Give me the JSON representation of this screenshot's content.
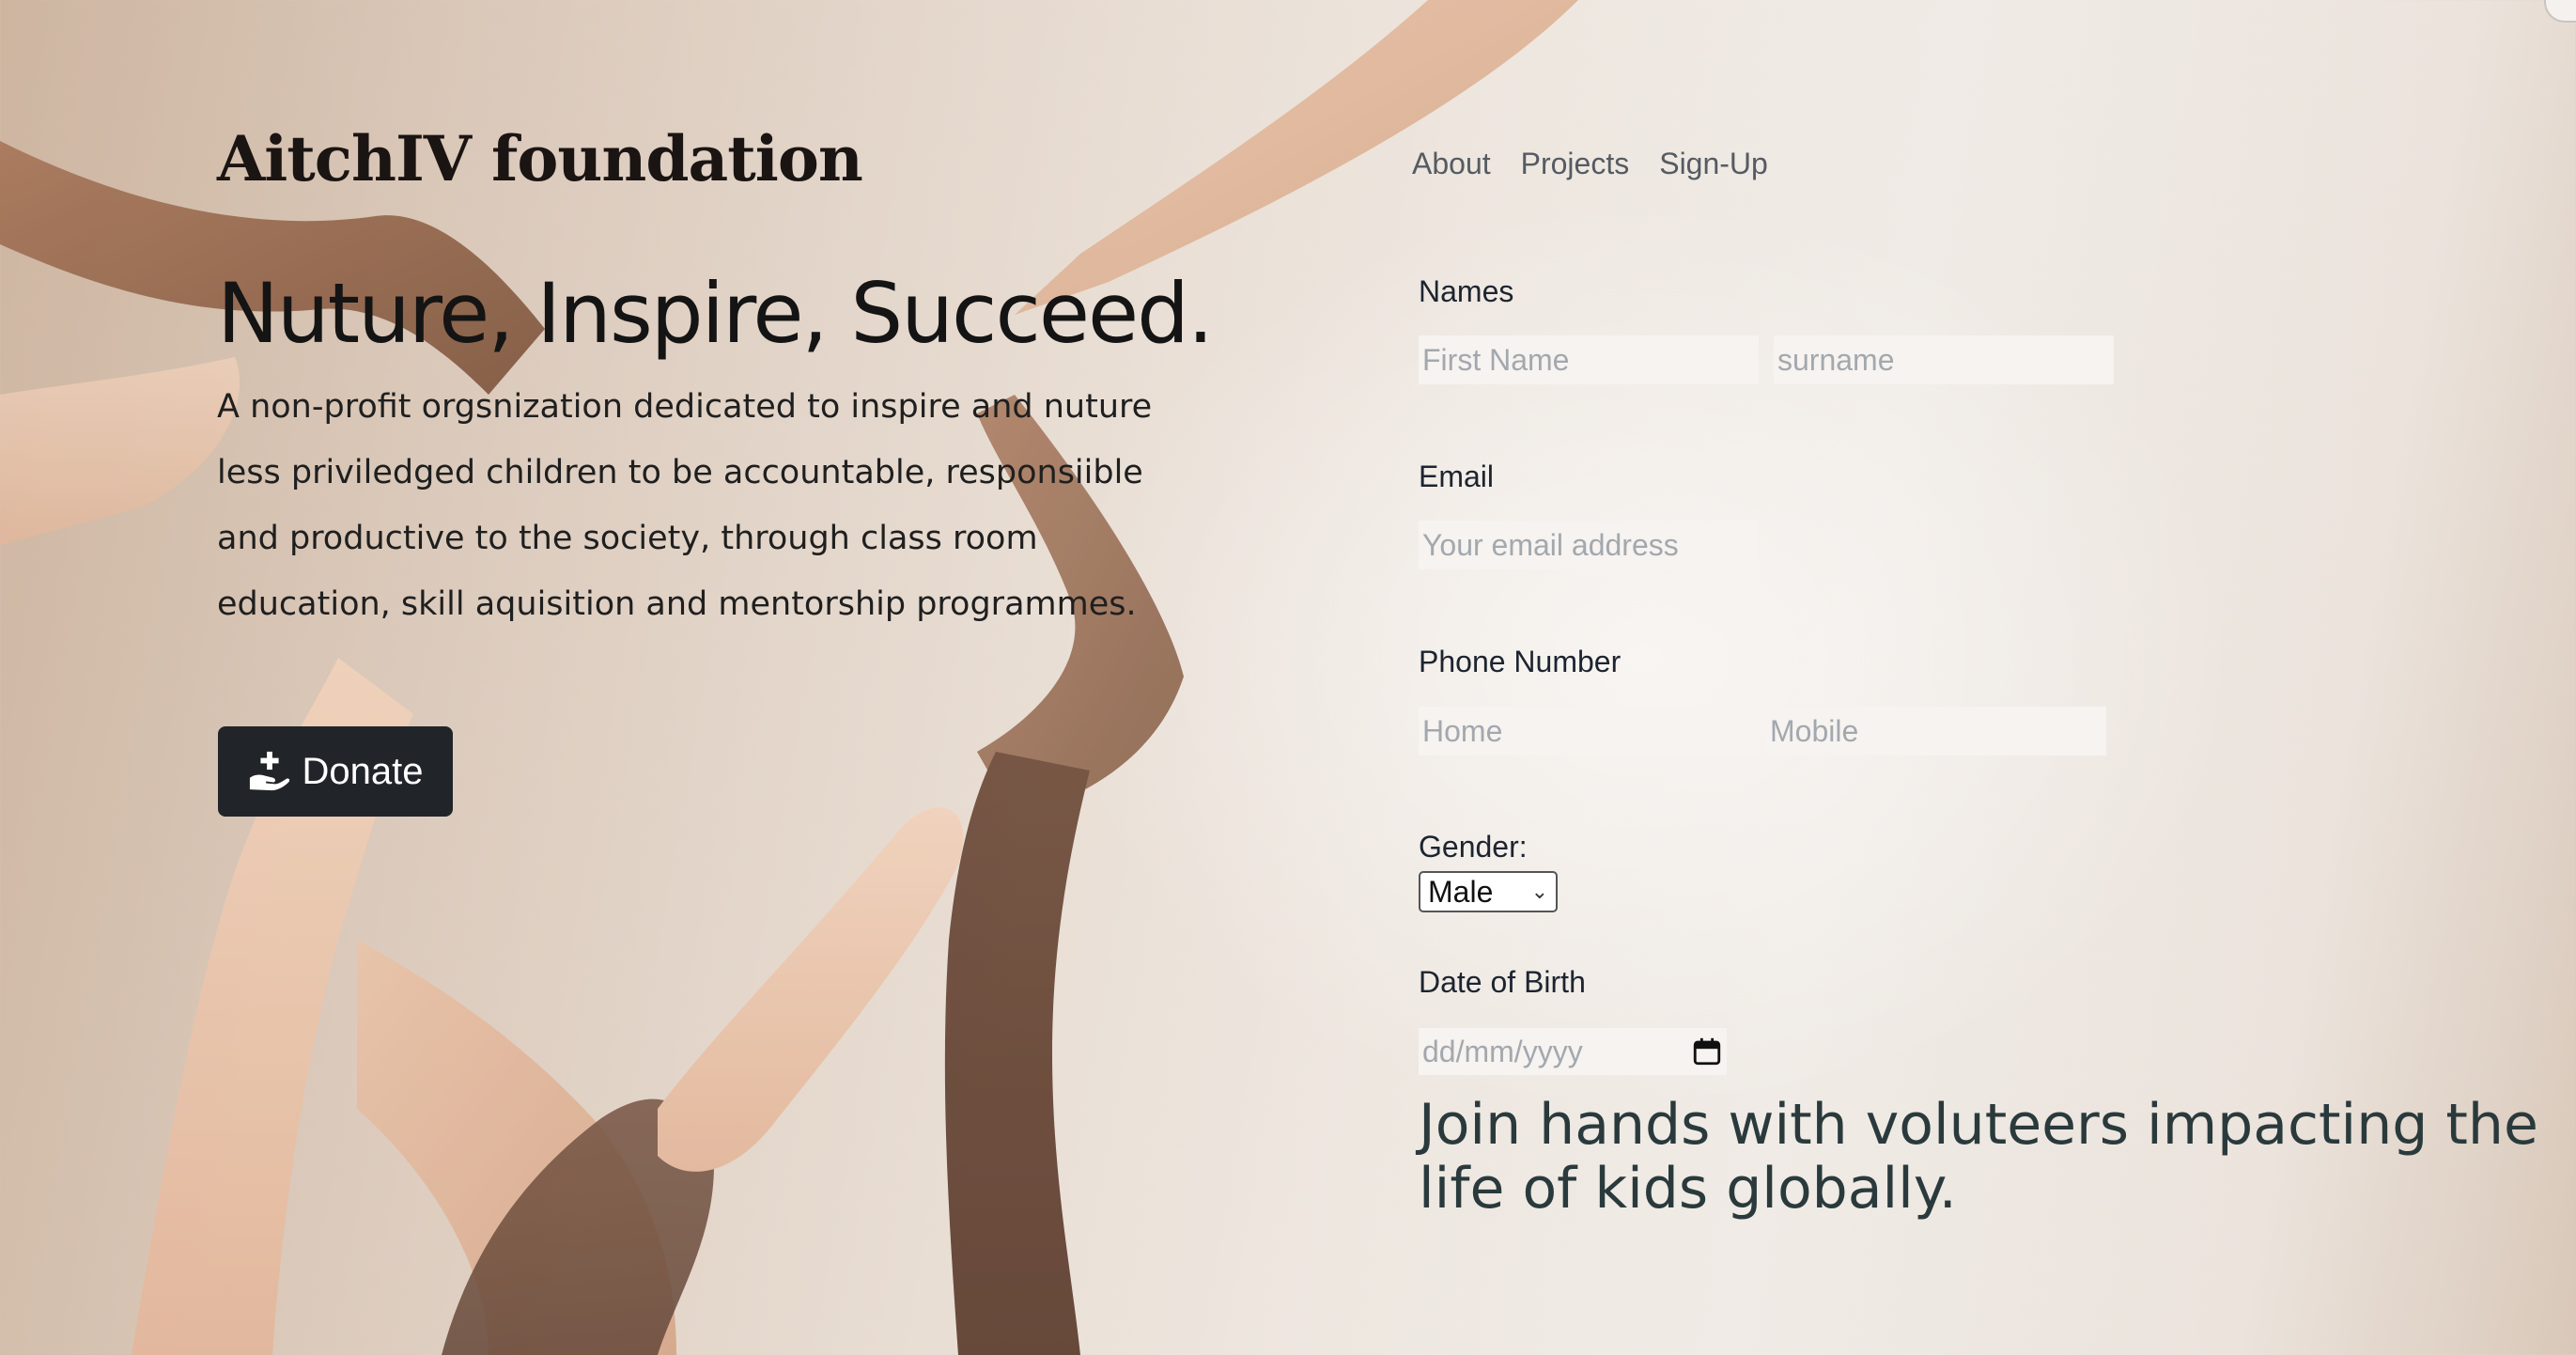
{
  "header": {
    "brand": "AitchIV foundation",
    "nav": [
      "About",
      "Projects",
      "Sign-Up"
    ]
  },
  "hero": {
    "headline": "Nuture, Inspire, Succeed.",
    "intro": "A non-profit orgsnization dedicated to inspire and nuture less priviledged children to be accountable, responsiible and productive to the society, through class room education, skill aquisition and mentorship programmes.",
    "donate_label": "Donate",
    "donate_icon": "hand-holding-plus-icon"
  },
  "form": {
    "names_label": "Names",
    "first_name_placeholder": "First Name",
    "surname_placeholder": "surname",
    "email_label": "Email",
    "email_placeholder": "Your email address",
    "phone_label": "Phone Number",
    "home_placeholder": "Home",
    "mobile_placeholder": "Mobile",
    "gender_label": "Gender:",
    "gender_value": "Male",
    "dob_label": "Date of Birth",
    "dob_placeholder": "dd/mm/yyyy",
    "calendar_icon": "calendar-icon"
  },
  "tagline": "Join hands with voluteers impacting the life of kids globally.",
  "colors": {
    "button_bg": "#212529",
    "nav_text": "#555b62",
    "tagline_text": "#2a3a3c"
  }
}
